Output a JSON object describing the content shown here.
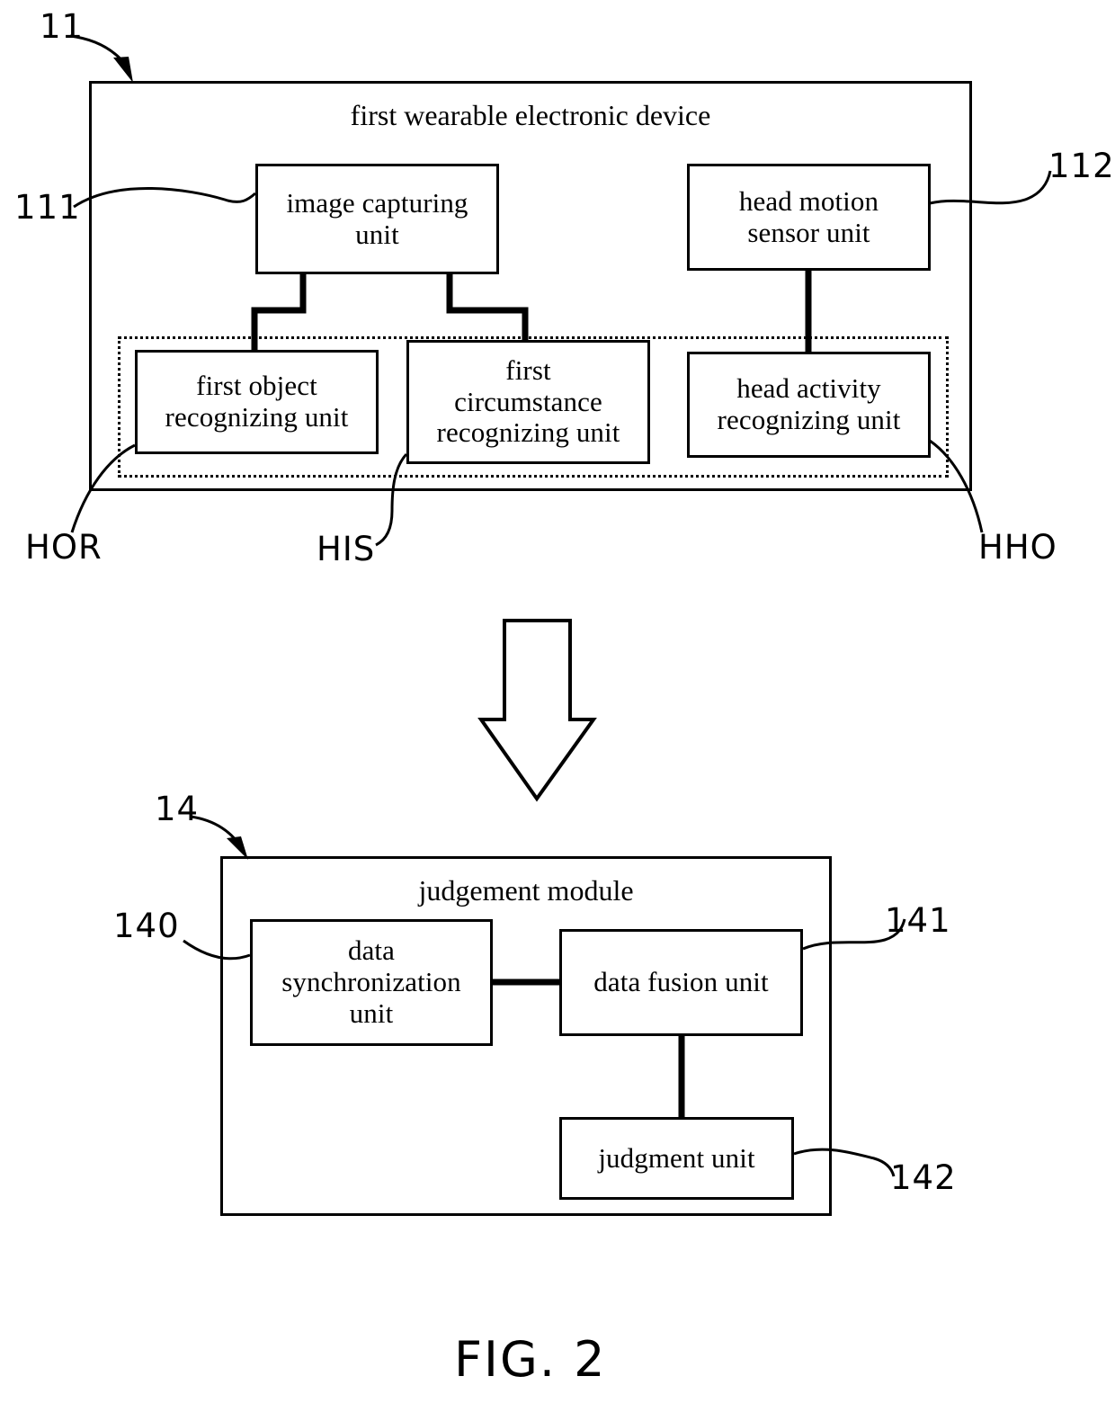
{
  "figure": {
    "caption": "FIG. 2",
    "top_block": {
      "title": "first wearable electronic device",
      "ref": "11",
      "units": [
        {
          "id": "image-capturing-unit",
          "label": "image capturing\nunit",
          "ref": "111"
        },
        {
          "id": "head-motion-sensor-unit",
          "label": "head motion\nsensor unit",
          "ref": "112"
        },
        {
          "id": "first-object-recognizing-unit",
          "label": "first object\nrecognizing unit",
          "signal": "HOR"
        },
        {
          "id": "first-circumstance-recognizing-unit",
          "label": "first\ncircumstance\nrecognizing unit",
          "signal": "HIS"
        },
        {
          "id": "head-activity-recognizing-unit",
          "label": "head activity\nrecognizing unit",
          "signal": "HHO"
        }
      ],
      "signals": [
        {
          "name": "HOR",
          "label": "HOR"
        },
        {
          "name": "HIS",
          "label": "HIS"
        },
        {
          "name": "HHO",
          "label": "HHO"
        }
      ]
    },
    "bottom_block": {
      "title": "judgement module",
      "ref": "14",
      "units": [
        {
          "id": "data-synchronization-unit",
          "label": "data\nsynchronization\nunit",
          "ref": "140"
        },
        {
          "id": "data-fusion-unit",
          "label": "data fusion unit",
          "ref": "141"
        },
        {
          "id": "judgment-unit",
          "label": "judgment unit",
          "ref": "142"
        }
      ]
    },
    "flow_arrow": {
      "name": "downward-block-arrow",
      "direction": "down"
    },
    "colors": {
      "stroke": "#000000",
      "background": "#ffffff"
    }
  }
}
